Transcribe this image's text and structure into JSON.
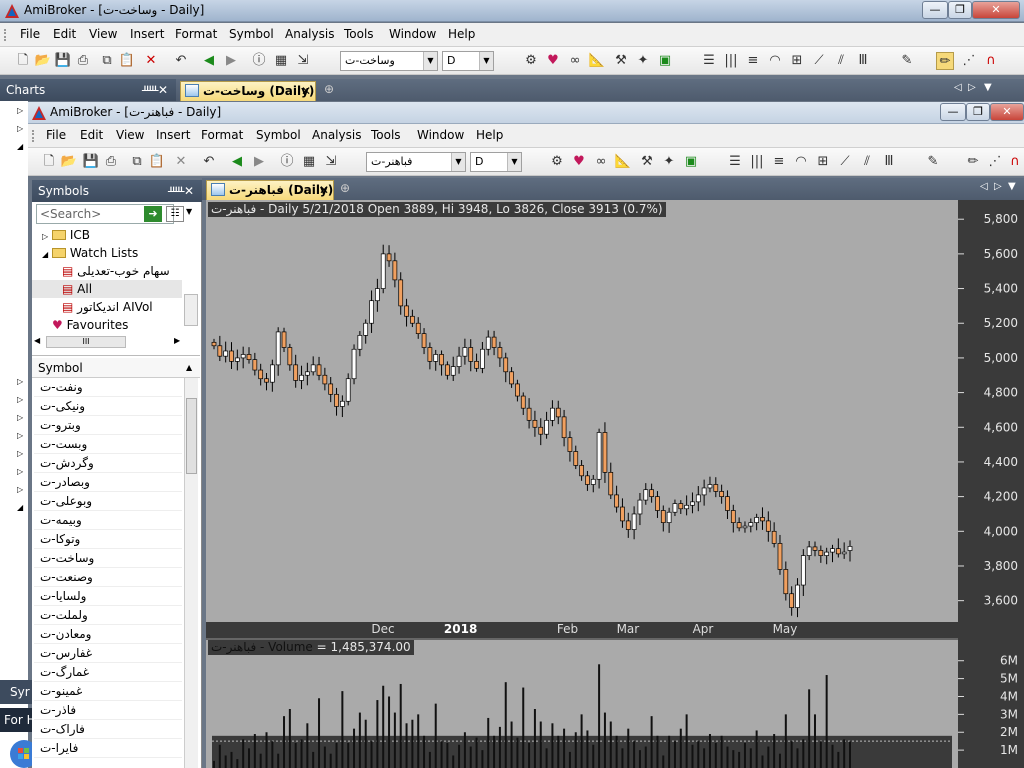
{
  "window": {
    "title": "AmiBroker - [وساخت-ت  -  Daily]",
    "min_label": "—",
    "max_label": "❐",
    "close_label": "✕"
  },
  "menu": [
    "File",
    "Edit",
    "View",
    "Insert",
    "Format",
    "Symbol",
    "Analysis",
    "Tools",
    "Window",
    "Help"
  ],
  "outer_toolbar": {
    "symbol": "وساخت-ت",
    "interval": "D"
  },
  "charts_pane": {
    "title": "Charts",
    "pin": "ᚊ",
    "close": "✕"
  },
  "outer_tab": {
    "label": "وساخت-ت (Daily)",
    "close": "✕"
  },
  "inner_window": {
    "title": "AmiBroker - [فباهنر-ت  -  Daily]",
    "symbol": "فباهنر-ت",
    "interval": "D",
    "tab_label": "فباهنر-ت (Daily)",
    "tab_close": "✕"
  },
  "symbols_panel": {
    "title": "Symbols",
    "pin": "ᚊ",
    "close": "✕",
    "search_placeholder": "<Search>",
    "tree": [
      "ICB",
      "Watch Lists",
      "سهام خوب-تعدیلی",
      "All",
      "اندیکاتور AIVol",
      "Favourites"
    ],
    "column_header": "Symbol",
    "symbols": [
      "ونفت-ت",
      "ونیکی-ت",
      "وبترو-ت",
      "وبست-ت",
      "وگردش-ت",
      "وبصادر-ت",
      "وبوعلی-ت",
      "وبیمه-ت",
      "وتوکا-ت",
      "وساخت-ت",
      "وصنعت-ت",
      "ولسایا-ت",
      "ولملت-ت",
      "ومعادن-ت",
      "غفارس-ت",
      "غمارگ-ت",
      "غمینو-ت",
      "فاذر-ت",
      "فاراک-ت",
      "فایرا-ت"
    ]
  },
  "left_edge": {
    "syr": "Syr",
    "forh": "For H"
  },
  "chart": {
    "header": "فباهنر-ت - Daily 5/21/2018 Open 3889, Hi 3948, Lo 3826, Close 3913 (0.7%)",
    "volume_header_name": "فباهنر-ت - Volume",
    "volume_header_value": " = 1,485,374.00"
  },
  "colors": {
    "up": "#ffffff",
    "down": "#f0a060",
    "chart_bg": "#aaaaaa",
    "axis_bg": "#3a3a3a"
  },
  "chart_data": {
    "type": "candlestick",
    "price_axis_ticks": [
      "5,800",
      "5,600",
      "5,400",
      "5,200",
      "5,000",
      "4,800",
      "4,600",
      "4,400",
      "4,200",
      "4,000",
      "3,800",
      "3,600"
    ],
    "price_axis_values": [
      5800,
      5600,
      5400,
      5200,
      5000,
      4800,
      4600,
      4400,
      4200,
      4000,
      3800,
      3600
    ],
    "ylim": [
      3500,
      5830
    ],
    "x_ticks": [
      "Dec",
      "2018",
      "Feb",
      "Mar",
      "Apr",
      "May"
    ],
    "volume_axis_ticks": [
      "6M",
      "5M",
      "4M",
      "3M",
      "2M",
      "1M"
    ],
    "volume_axis_values": [
      6000000,
      5000000,
      4000000,
      3000000,
      2000000,
      1000000
    ],
    "volume_ylim": [
      0,
      6600000
    ],
    "last_bar": {
      "date": "5/21/2018",
      "open": 3889,
      "high": 3948,
      "low": 3826,
      "close": 3913,
      "change_pct": 0.7,
      "volume": 1485374
    },
    "closes": [
      5070,
      5010,
      5040,
      4980,
      5000,
      5020,
      4990,
      4930,
      4880,
      4860,
      4960,
      5150,
      5060,
      4960,
      4870,
      4900,
      4920,
      4960,
      4900,
      4850,
      4790,
      4720,
      4750,
      4880,
      5050,
      5130,
      5200,
      5330,
      5400,
      5600,
      5560,
      5450,
      5300,
      5240,
      5200,
      5140,
      5060,
      4980,
      5020,
      4960,
      4900,
      4950,
      5010,
      5060,
      4980,
      4940,
      5050,
      5120,
      5060,
      5000,
      4920,
      4850,
      4780,
      4710,
      4640,
      4600,
      4560,
      4640,
      4710,
      4660,
      4540,
      4460,
      4380,
      4320,
      4270,
      4300,
      4570,
      4340,
      4210,
      4140,
      4060,
      4010,
      4100,
      4180,
      4240,
      4200,
      4120,
      4050,
      4110,
      4160,
      4130,
      4150,
      4170,
      4210,
      4250,
      4270,
      4230,
      4200,
      4120,
      4050,
      4020,
      4030,
      4050,
      4080,
      4060,
      4000,
      3930,
      3780,
      3640,
      3560,
      3690,
      3860,
      3910,
      3890,
      3860,
      3880,
      3900,
      3870,
      3880,
      3913
    ],
    "volumes": [
      400000,
      1300000,
      700000,
      900000,
      500000,
      1600000,
      1100000,
      1900000,
      800000,
      2000000,
      1500000,
      800000,
      2900000,
      3300000,
      1400000,
      1600000,
      2500000,
      900000,
      3900000,
      1200000,
      800000,
      1400000,
      4300000,
      1400000,
      2200000,
      3100000,
      2700000,
      1500000,
      3800000,
      4600000,
      4000000,
      3100000,
      4700000,
      2500000,
      2700000,
      3000000,
      1800000,
      900000,
      3600000,
      1500000,
      1400000,
      700000,
      1300000,
      2000000,
      1200000,
      1700000,
      1000000,
      2800000,
      1800000,
      2300000,
      4800000,
      2600000,
      1700000,
      4500000,
      1400000,
      3300000,
      2600000,
      1100000,
      2500000,
      1800000,
      2200000,
      900000,
      2000000,
      3000000,
      2100000,
      1300000,
      5800000,
      3100000,
      2600000,
      1800000,
      1100000,
      2200000,
      1500000,
      1000000,
      1200000,
      2900000,
      1800000,
      700000,
      1800000,
      1500000,
      2200000,
      3000000,
      1300000,
      1500000,
      1100000,
      1900000,
      1400000,
      1800000,
      1200000,
      1000000,
      900000,
      1400000,
      1100000,
      2100000,
      700000,
      1200000,
      1900000,
      800000,
      3000000,
      1500000,
      1100000,
      1600000,
      4400000,
      3000000,
      1500000,
      5200000,
      1300000,
      900000,
      1600000,
      1485374
    ]
  }
}
